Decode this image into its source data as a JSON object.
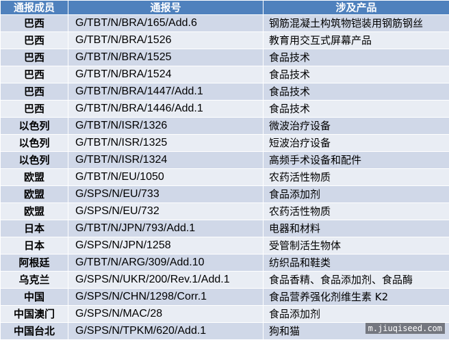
{
  "table": {
    "headers": [
      "通报成员",
      "通报号",
      "涉及产品"
    ],
    "rows": [
      {
        "member": "巴西",
        "code": "G/TBT/N/BRA/165/Add.6",
        "product": "钢筋混凝土构筑物铠装用钢筋钢丝"
      },
      {
        "member": "巴西",
        "code": "G/TBT/N/BRA/1526",
        "product": "教育用交互式屏幕产品"
      },
      {
        "member": "巴西",
        "code": "G/TBT/N/BRA/1525",
        "product": "食品技术"
      },
      {
        "member": "巴西",
        "code": "G/TBT/N/BRA/1524",
        "product": "食品技术"
      },
      {
        "member": "巴西",
        "code": "G/TBT/N/BRA/1447/Add.1",
        "product": "食品技术"
      },
      {
        "member": "巴西",
        "code": "G/TBT/N/BRA/1446/Add.1",
        "product": "食品技术"
      },
      {
        "member": "以色列",
        "code": "G/TBT/N/ISR/1326",
        "product": "微波治疗设备"
      },
      {
        "member": "以色列",
        "code": "G/TBT/N/ISR/1325",
        "product": "短波治疗设备"
      },
      {
        "member": "以色列",
        "code": "G/TBT/N/ISR/1324",
        "product": "高频手术设备和配件"
      },
      {
        "member": "欧盟",
        "code": "G/TBT/N/EU/1050",
        "product": "农药活性物质"
      },
      {
        "member": "欧盟",
        "code": "G/SPS/N/EU/733",
        "product": "食品添加剂"
      },
      {
        "member": "欧盟",
        "code": "G/SPS/N/EU/732",
        "product": "农药活性物质"
      },
      {
        "member": "日本",
        "code": "G/TBT/N/JPN/793/Add.1",
        "product": "电器和材料"
      },
      {
        "member": "日本",
        "code": "G/SPS/N/JPN/1258",
        "product": "受管制活生物体"
      },
      {
        "member": "阿根廷",
        "code": "G/TBT/N/ARG/309/Add.10",
        "product": "纺织品和鞋类"
      },
      {
        "member": "乌克兰",
        "code": "G/SPS/N/UKR/200/Rev.1/Add.1",
        "product": "食品香精、食品添加剂、食品酶"
      },
      {
        "member": "中国",
        "code": "G/SPS/N/CHN/1298/Corr.1",
        "product": "食品营养强化剂维生素 K2"
      },
      {
        "member": "中国澳门",
        "code": "G/SPS/N/MAC/28",
        "product": "食品添加剂"
      },
      {
        "member": "中国台北",
        "code": "G/SPS/N/TPKM/620/Add.1",
        "product": "狗和猫"
      }
    ]
  },
  "watermark": "m.jiuqiseed.com"
}
